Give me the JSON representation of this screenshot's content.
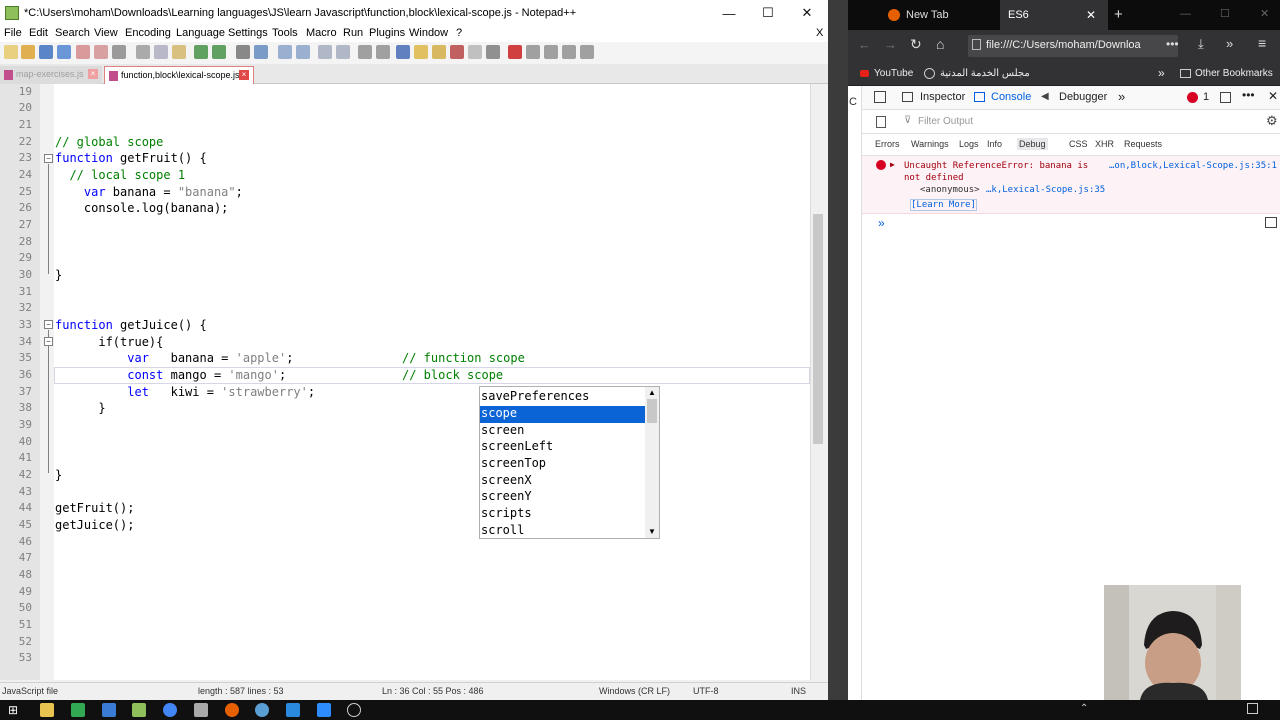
{
  "npp": {
    "title": "*C:\\Users\\moham\\Downloads\\Learning languages\\JS\\learn Javascript\\function,block\\lexical-scope.js - Notepad++",
    "menu": [
      "File",
      "Edit",
      "Search",
      "View",
      "Encoding",
      "Language",
      "Settings",
      "Tools",
      "Macro",
      "Run",
      "Plugins",
      "Window",
      "?"
    ],
    "close_x": "X",
    "tabs": [
      {
        "label": "map-exercises.js"
      },
      {
        "label": "function,block\\lexical-scope.js"
      }
    ],
    "line_numbers": [
      "19",
      "20",
      "21",
      "22",
      "23",
      "24",
      "25",
      "26",
      "27",
      "28",
      "29",
      "30",
      "31",
      "32",
      "33",
      "34",
      "35",
      "36",
      "37",
      "38",
      "39",
      "40",
      "41",
      "42",
      "43",
      "44",
      "45",
      "46",
      "47",
      "48",
      "49",
      "50",
      "51",
      "52",
      "53"
    ],
    "code": {
      "l22": "// global scope",
      "l23a": "function",
      "l23b": " getFruit() {",
      "l24": "  // local scope 1",
      "l25a": "    var",
      "l25b": " banana = ",
      "l25c": "\"banana\"",
      "l25d": ";",
      "l26": "    console.log(banana);",
      "l30": "}",
      "l33a": "function",
      "l33b": " getJuice() {",
      "l34": "      if(true){",
      "l35a": "          var",
      "l35b": "   banana = ",
      "l35c": "'apple'",
      "l35d": ";",
      "l35e": "// function scope",
      "l36a": "          const",
      "l36b": " mango = ",
      "l36c": "'mango'",
      "l36d": ";",
      "l36e": "// block scope",
      "l37a": "          let",
      "l37b": "   kiwi = ",
      "l37c": "'strawberry'",
      "l37d": ";",
      "l38": "      }",
      "l42": "}",
      "l44": "getFruit();",
      "l45": "getJuice();"
    },
    "autocomplete": {
      "items": [
        "savePreferences",
        "scope",
        "screen",
        "screenLeft",
        "screenTop",
        "screenX",
        "screenY",
        "scripts",
        "scroll"
      ],
      "selected": "scope"
    },
    "status": {
      "type": "JavaScript file",
      "length": "length : 587    lines : 53",
      "pos": "Ln : 36    Col : 55    Pos : 486",
      "eol": "Windows (CR LF)",
      "enc": "UTF-8",
      "mode": "INS"
    }
  },
  "firefox": {
    "tabs": [
      {
        "label": "New Tab"
      },
      {
        "label": "ES6"
      }
    ],
    "url": "file:///C:/Users/moham/Downloa",
    "bookmarks": {
      "youtube": "YouTube",
      "arabic": "مجلس الخدمة المدنية",
      "other": "Other Bookmarks"
    },
    "page_letter": "C",
    "devtools": {
      "tabs": [
        "Inspector",
        "Console",
        "Debugger"
      ],
      "selected_tab": "Console",
      "error_count": "1",
      "filter_placeholder": "Filter Output",
      "categories": [
        "Errors",
        "Warnings",
        "Logs",
        "Info",
        "Debug",
        "CSS",
        "XHR",
        "Requests"
      ],
      "error": {
        "line1": "Uncaught ReferenceError: banana is",
        "line2": "not defined",
        "source": "…on,Block,Lexical-Scope.js:35:1",
        "frame_fn": "<anonymous>",
        "frame_src": "…k,Lexical-Scope.js:35",
        "learn_more": "[Learn More]"
      },
      "prompt": "»"
    }
  },
  "colors": {
    "npp_keyword": "#0000ff",
    "npp_comment": "#008000",
    "npp_string": "#808080",
    "ac_selected": "#0a64d6",
    "ff_accent": "#0060df",
    "error_text": "#a4000f"
  }
}
